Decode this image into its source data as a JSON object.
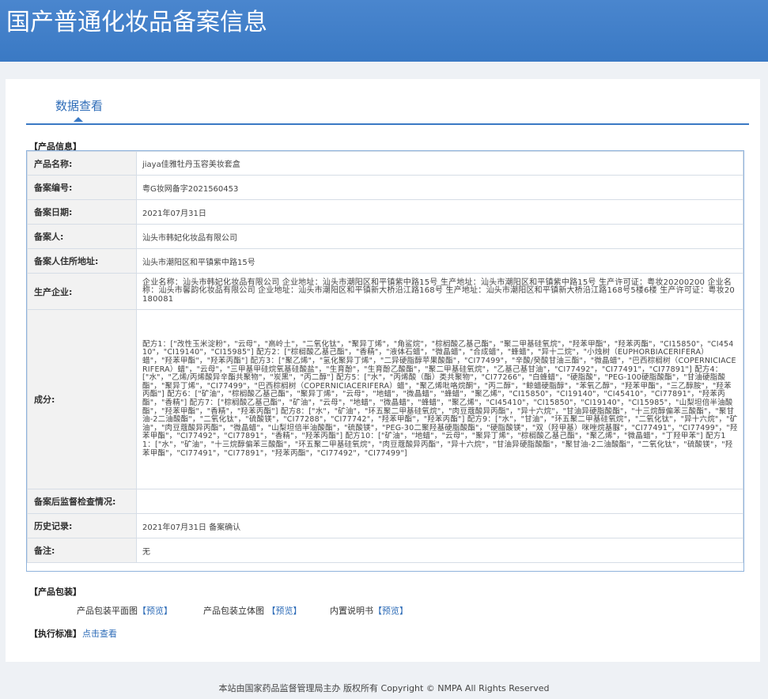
{
  "header": {
    "title": "国产普通化妆品备案信息"
  },
  "tabs": [
    {
      "label": "数据查看"
    }
  ],
  "product_info": {
    "section_title": "【产品信息】",
    "rows": [
      {
        "label": "产品名称:",
        "value": "jiaya佳雅牡丹玉容美妆套盒"
      },
      {
        "label": "备案编号:",
        "value": "粤G妆网备字2021560453"
      },
      {
        "label": "备案日期:",
        "value": "2021年07月31日"
      },
      {
        "label": "备案人:",
        "value": "汕头市韩妃化妆品有限公司"
      },
      {
        "label": "备案人住所地址:",
        "value": "汕头市潮阳区和平镇紫中路15号"
      },
      {
        "label": "生产企业:",
        "value": "企业名称：汕头市韩妃化妆品有限公司 企业地址：汕头市潮阳区和平镇紫中路15号 生产地址：汕头市潮阳区和平镇紫中路15号 生产许可证：粤妆20200200 企业名称：汕头市馨韵化妆品有限公司 企业地址：汕头市潮阳区和平镇新大桥沿江路168号 生产地址：汕头市潮阳区和平镇新大桥沿江路168号5楼6楼 生产许可证：粤妆20180081"
      },
      {
        "label": "成分:",
        "value": "配方1：[\"改性玉米淀粉\"，\"云母\"，\"高岭土\"，\"二氧化钛\"，\"聚异丁烯\"，\"角鲨烷\"，\"棕榈酸乙基己酯\"，\"聚二甲基硅氧烷\"，\"羟苯甲酯\"，\"羟苯丙酯\"，\"CI15850\"，\"CI45410\"，\"CI19140\"，\"CI15985\"] 配方2：[\"棕榈酸乙基己酯\"，\"香精\"，\"液体石蜡\"，\"微晶蜡\"，\"合成蜡\"，\"蜂蜡\"，\"异十二烷\"，\"小烛树（EUPHORBIACERIFERA）蜡\"，\"羟苯甲酯\"，\"羟苯丙酯\"] 配方3：[\"聚乙烯\"，\"氢化聚异丁烯\"，\"二异硬脂醇苹果酸酯\"，\"CI77499\"，\"辛酸/癸酸甘油三酯\"，\"微晶蜡\"，\"巴西棕榈树（COPERNICIACERIFERA）蜡\"，\"云母\"，\"三甲基甲硅烷氧基硅酸盐\"，\"生育酚\"，\"生育酚乙酸酯\"，\"聚二甲基硅氧烷\"，\"乙基己基甘油\"，\"CI77492\"，\"CI77491\"，\"CI77891\"] 配方4：[\"水\"，\"乙烯/丙烯酸异辛酯共聚物\"，\"炭黑\"，\"丙二醇\"] 配方5：[\"水\"，\"丙烯酸（酯）类共聚物\"，\"CI77266\"，\"白蜂蜡\"，\"硬脂酸\"，\"PEG-100硬脂酸酯\"，\"甘油硬脂酸酯\"，\"聚异丁烯\"，\"CI77499\"，\"巴西棕榈树（COPERNICIACERIFERA）蜡\"，\"聚乙烯吡咯烷酮\"，\"丙二醇\"，\"鲸蜡硬脂醇\"，\"苯氧乙醇\"，\"羟苯甲酯\"，\"三乙醇胺\"，\"羟苯丙酯\"] 配方6：[\"矿油\"，\"棕榈酸乙基己酯\"，\"聚异丁烯\"，\"云母\"，\"地蜡\"，\"微晶蜡\"，\"蜂蜡\"，\"聚乙烯\"，\"CI15850\"，\"CI19140\"，\"CI45410\"，\"CI77891\"，\"羟苯丙酯\"，\"香精\"] 配方7：[\"棕榈酸乙基己酯\"，\"矿油\"，\"云母\"，\"地蜡\"，\"微晶蜡\"，\"蜂蜡\"，\"聚乙烯\"，\"CI45410\"，\"CI15850\"，\"CI19140\"，\"CI15985\"，\"山梨坦倍半油酸酯\"，\"羟苯甲酯\"，\"香精\"，\"羟苯丙酯\"] 配方8：[\"水\"，\"矿油\"，\"环五聚二甲基硅氧烷\"，\"肉豆蔻酸异丙酯\"，\"异十六烷\"，\"甘油异硬脂酸酯\"，\"十三烷醇偏苯三酸酯\"，\"聚甘油-2二油酸酯\"，\"二氧化钛\"，\"硫酸镁\"，\"CI77288\"，\"CI77742\"，\"羟苯甲酯\"，\"羟苯丙酯\"] 配方9：[\"水\"，\"甘油\"，\"环五聚二甲基硅氧烷\"，\"二氧化钛\"，\"异十六烷\"，\"矿油\"，\"肉豆蔻酸异丙酯\"，\"微晶蜡\"，\"山梨坦倍半油酸酯\"，\"硫酸镁\"，\"PEG-30二聚羟基硬脂酸酯\"，\"硬脂酸镁\"，\"双（羟甲基）咪唑烷基脲\"，\"CI77491\"，\"CI77499\"，\"羟苯甲酯\"，\"CI77492\"，\"CI77891\"，\"香精\"，\"羟苯丙酯\"] 配方10：[\"矿油\"，\"地蜡\"，\"云母\"，\"聚异丁烯\"，\"棕榈酸乙基己酯\"，\"聚乙烯\"，\"微晶蜡\"，\"丁羟甲苯\"] 配方11：[\"水\"，\"矿油\"，\"十三烷醇偏苯三酸酯\"，\"环五聚二甲基硅氧烷\"，\"肉豆蔻酸异丙酯\"，\"异十六烷\"，\"甘油异硬脂酸酯\"，\"聚甘油-2二油酸酯\"，\"二氧化钛\"，\"硫酸镁\"，\"羟苯甲酯\"，\"CI77491\"，\"CI77891\"，\"羟苯丙酯\"，\"CI77492\"，\"CI77499\"]"
      },
      {
        "label": "备案后监督检查情况:",
        "value": ""
      },
      {
        "label": "历史记录:",
        "value": "2021年07月31日 备案确认"
      },
      {
        "label": "备注:",
        "value": "无"
      }
    ]
  },
  "packaging": {
    "section_title": "【产品包装】",
    "items": [
      {
        "label": "产品包装平面图",
        "link": "【预览】"
      },
      {
        "label": "产品包装立体图",
        "link": "【预览】"
      },
      {
        "label": "内置说明书",
        "link": "【预览】"
      }
    ]
  },
  "standard": {
    "label": "【执行标准】",
    "link": "点击查看"
  },
  "footer": {
    "text": "本站由国家药品监督管理局主办 版权所有 Copyright © NMPA All Rights Reserved"
  },
  "colors": {
    "header": "#3a79c4",
    "link": "#2f6db8",
    "border": "#8fb3dc"
  }
}
